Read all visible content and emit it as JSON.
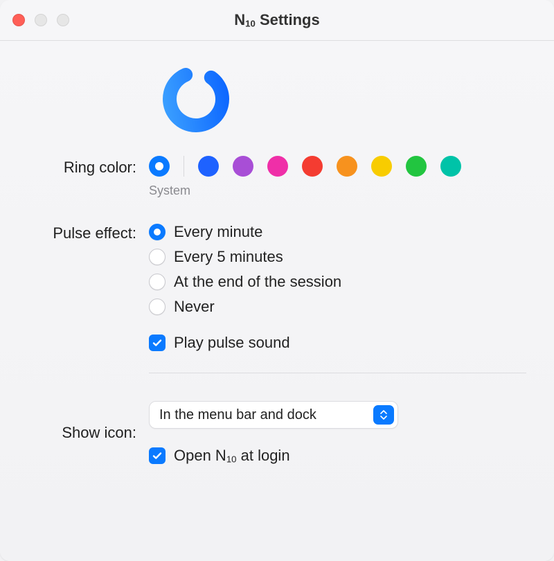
{
  "window": {
    "title_prefix": "N",
    "title_sub": "10",
    "title_suffix": " Settings"
  },
  "labels": {
    "ring_color": "Ring color:",
    "pulse_effect": "Pulse effect:",
    "show_icon": "Show icon:"
  },
  "ring_color": {
    "system_label": "System",
    "options": [
      {
        "name": "system",
        "hex": "#0a7aff",
        "selected": true
      },
      {
        "name": "blue",
        "hex": "#1e62ff"
      },
      {
        "name": "purple",
        "hex": "#a84ed6"
      },
      {
        "name": "magenta",
        "hex": "#ef2fa8"
      },
      {
        "name": "red",
        "hex": "#f43c31"
      },
      {
        "name": "orange",
        "hex": "#f7921e"
      },
      {
        "name": "yellow",
        "hex": "#f8cc00"
      },
      {
        "name": "green",
        "hex": "#22c540"
      },
      {
        "name": "teal",
        "hex": "#00c3a8"
      }
    ]
  },
  "pulse_effect": {
    "options": [
      {
        "label": "Every minute",
        "selected": true
      },
      {
        "label": "Every 5 minutes",
        "selected": false
      },
      {
        "label": "At the end of the session",
        "selected": false
      },
      {
        "label": "Never",
        "selected": false
      }
    ],
    "play_sound": {
      "label": "Play pulse sound",
      "checked": true
    }
  },
  "show_icon": {
    "value": "In the menu bar and dock"
  },
  "open_at_login": {
    "label_prefix": "Open N",
    "label_sub": "10",
    "label_suffix": " at login",
    "checked": true
  },
  "colors": {
    "accent": "#0a7aff"
  }
}
